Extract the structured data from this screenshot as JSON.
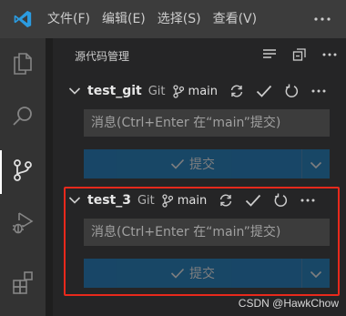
{
  "titlebar": {
    "menu": [
      "文件(F)",
      "编辑(E)",
      "选择(S)",
      "查看(V)"
    ],
    "more_icon": "ellipsis-icon"
  },
  "activitybar": {
    "items": [
      {
        "name": "explorer",
        "icon": "files-icon"
      },
      {
        "name": "search",
        "icon": "search-icon"
      },
      {
        "name": "source-control",
        "icon": "source-control-icon",
        "active": true
      },
      {
        "name": "run-debug",
        "icon": "run-debug-icon"
      },
      {
        "name": "extensions",
        "icon": "extensions-icon"
      }
    ]
  },
  "scm": {
    "header": "源代码管理",
    "repos": [
      {
        "name": "test_git",
        "provider": "Git",
        "branch": "main",
        "message_placeholder": "消息(Ctrl+Enter 在“main”提交)",
        "commit_label": "提交"
      },
      {
        "name": "test_3",
        "provider": "Git",
        "branch": "main",
        "message_placeholder": "消息(Ctrl+Enter 在“main”提交)",
        "commit_label": "提交"
      }
    ]
  },
  "colors": {
    "highlight": "#e8291c",
    "commit_button": "#0e639c"
  },
  "watermark": "CSDN @HawkChow"
}
